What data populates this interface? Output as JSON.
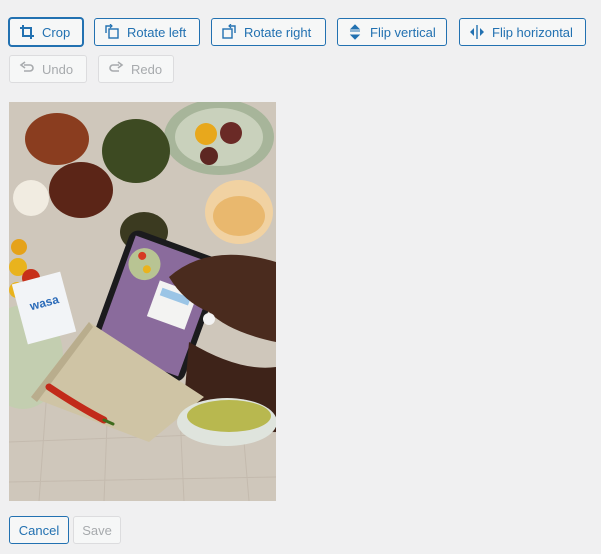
{
  "toolbar": {
    "crop_label": "Crop",
    "rotate_left_label": "Rotate left",
    "rotate_right_label": "Rotate right",
    "flip_vertical_label": "Flip vertical",
    "flip_horizontal_label": "Flip horizontal",
    "undo_label": "Undo",
    "redo_label": "Redo"
  },
  "footer": {
    "cancel_label": "Cancel",
    "save_label": "Save"
  },
  "colors": {
    "accent": "#2271b1",
    "disabled": "#a7aaad",
    "background": "#f0f0f1"
  }
}
